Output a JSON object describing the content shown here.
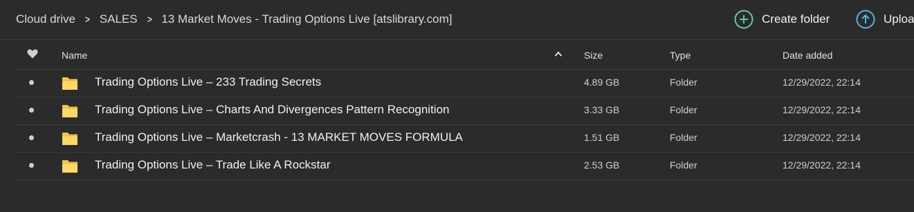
{
  "breadcrumb": {
    "items": [
      "Cloud drive",
      "SALES",
      "13 Market Moves - Trading Options Live [atslibrary.com]"
    ]
  },
  "actions": {
    "create_folder": "Create folder",
    "upload": "Uploa"
  },
  "colors": {
    "create_folder_icon": "#5fc9a8",
    "upload_icon": "#4fb6e8",
    "folder": "#f6c744"
  },
  "table": {
    "columns": {
      "name": "Name",
      "size": "Size",
      "type": "Type",
      "date": "Date added"
    },
    "rows": [
      {
        "name": "Trading Options Live – 233 Trading Secrets",
        "size": "4.89 GB",
        "type": "Folder",
        "date": "12/29/2022, 22:14"
      },
      {
        "name": "Trading Options Live – Charts And Divergences Pattern Recognition",
        "size": "3.33 GB",
        "type": "Folder",
        "date": "12/29/2022, 22:14"
      },
      {
        "name": "Trading Options Live – Marketcrash - 13 MARKET MOVES FORMULA",
        "size": "1.51 GB",
        "type": "Folder",
        "date": "12/29/2022, 22:14"
      },
      {
        "name": "Trading Options Live – Trade Like A Rockstar",
        "size": "2.53 GB",
        "type": "Folder",
        "date": "12/29/2022, 22:14"
      }
    ]
  }
}
